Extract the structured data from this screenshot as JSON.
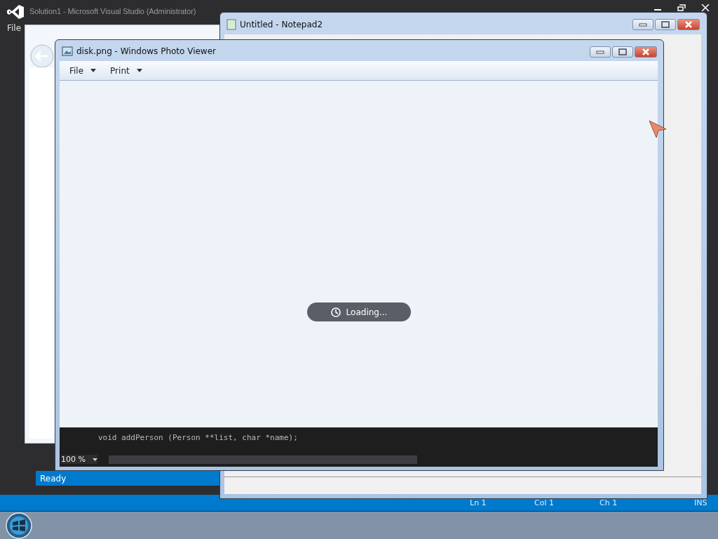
{
  "visual_studio": {
    "title": "Solution1 - Microsoft Visual Studio (Administrator)",
    "menu": [
      "File"
    ],
    "status": "Ready",
    "status_items": [
      "Ln 1",
      "Col 1",
      "Ch 1",
      "INS"
    ]
  },
  "notepad": {
    "title": "Untitled - Notepad2"
  },
  "photo_viewer": {
    "title": "disk.png - Windows Photo Viewer",
    "toolbar": [
      "File",
      "Print"
    ],
    "loading": "Loading...",
    "zoom": "100 %"
  },
  "code_editor": {
    "line": "void addPerson (Person **list, char *name);"
  }
}
